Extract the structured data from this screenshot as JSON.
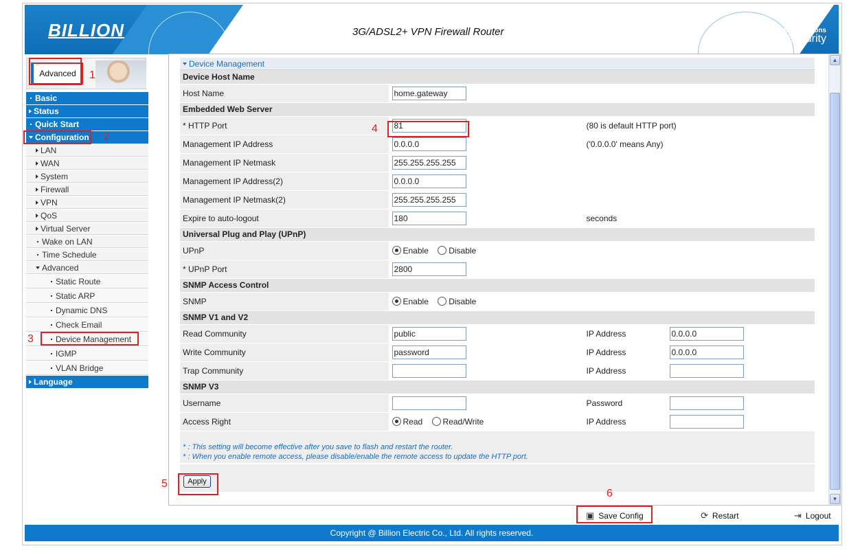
{
  "header": {
    "logo": "BILLION",
    "title": "3G/ADSL2+ VPN Firewall Router",
    "tagline_1": "Powering communications",
    "tagline_2": "with Security"
  },
  "sidebar": {
    "mode_label": "Advanced",
    "items": {
      "basic": "Basic",
      "status": "Status",
      "quick_start": "Quick Start",
      "configuration": "Configuration",
      "language": "Language"
    },
    "config_items": {
      "lan": "LAN",
      "wan": "WAN",
      "system": "System",
      "firewall": "Firewall",
      "vpn": "VPN",
      "qos": "QoS",
      "virtual_server": "Virtual Server",
      "wake_on_lan": "Wake on LAN",
      "time_schedule": "Time Schedule",
      "advanced": "Advanced"
    },
    "advanced_items": {
      "static_route": "Static Route",
      "static_arp": "Static ARP",
      "dynamic_dns": "Dynamic DNS",
      "check_email": "Check Email",
      "device_management": "Device Management",
      "igmp": "IGMP",
      "vlan_bridge": "VLAN Bridge"
    }
  },
  "annotations": {
    "n1": "1",
    "n2": "2",
    "n3": "3",
    "n4": "4",
    "n5": "5",
    "n6": "6"
  },
  "form": {
    "section_title": "Device Management",
    "device_host_name": {
      "header": "Device Host Name",
      "host_name_label": "Host Name",
      "host_name": "home.gateway"
    },
    "web_server": {
      "header": "Embedded Web Server",
      "http_port_label": "* HTTP Port",
      "http_port": "81",
      "http_port_note": "(80 is default HTTP port)",
      "mgmt_ip_label": "Management IP Address",
      "mgmt_ip": "0.0.0.0",
      "mgmt_ip_note": "('0.0.0.0' means Any)",
      "mgmt_mask_label": "Management IP Netmask",
      "mgmt_mask": "255.255.255.255",
      "mgmt_ip2_label": "Management IP Address(2)",
      "mgmt_ip2": "0.0.0.0",
      "mgmt_mask2_label": "Management IP Netmask(2)",
      "mgmt_mask2": "255.255.255.255",
      "expire_label": "Expire to auto-logout",
      "expire": "180",
      "expire_unit": "seconds"
    },
    "upnp": {
      "header": "Universal Plug and Play (UPnP)",
      "upnp_label": "UPnP",
      "enable": "Enable",
      "disable": "Disable",
      "port_label": "* UPnP Port",
      "port": "2800"
    },
    "snmp": {
      "header": "SNMP Access Control",
      "snmp_label": "SNMP",
      "enable": "Enable",
      "disable": "Disable"
    },
    "snmp_v1v2": {
      "header": "SNMP V1 and V2",
      "read_label": "Read Community",
      "read": "public",
      "write_label": "Write Community",
      "write": "password",
      "trap_label": "Trap Community",
      "trap": "",
      "ip_label": "IP Address",
      "read_ip": "0.0.0.0",
      "write_ip": "0.0.0.0",
      "trap_ip": ""
    },
    "snmp_v3": {
      "header": "SNMP V3",
      "username_label": "Username",
      "username": "",
      "password_label": "Password",
      "password": "",
      "access_label": "Access Right",
      "read": "Read",
      "read_write": "Read/Write",
      "ip_label": "IP Address",
      "ip": ""
    },
    "notes": {
      "note1": "* : This setting will become effective after you save to flash and restart the router.",
      "note2": "* : When you enable remote access, please disable/enable the remote access to update the HTTP port."
    },
    "apply_label": "Apply"
  },
  "actions": {
    "save_config": "Save Config",
    "restart": "Restart",
    "logout": "Logout"
  },
  "footer": {
    "copyright": "Copyright @ Billion Electric Co., Ltd. All rights reserved."
  },
  "colors": {
    "brand_blue": "#0f7acb",
    "annotation_red": "#e02020"
  }
}
